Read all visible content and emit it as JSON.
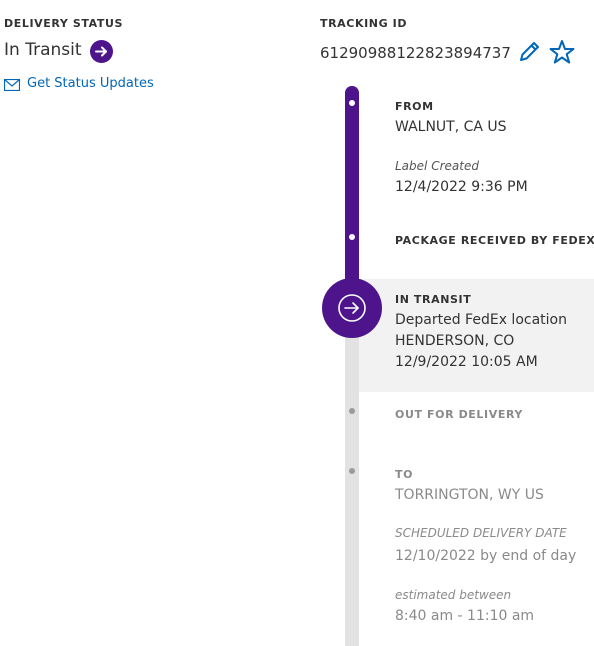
{
  "delivery_status": {
    "heading": "DELIVERY STATUS",
    "status": "In Transit",
    "status_icon": "arrow-right-circle-icon",
    "updates_link": "Get Status Updates",
    "updates_icon": "envelope-icon"
  },
  "tracking": {
    "heading": "TRACKING ID",
    "id": "612909881228238947 37",
    "id_display": "612909881228238947​37",
    "edit_icon": "pencil-icon",
    "favorite_icon": "star-icon"
  },
  "timeline": {
    "from": {
      "label": "FROM",
      "location": "WALNUT, CA US",
      "event_label": "Label Created",
      "event_time": "12/4/2022 9:36 PM"
    },
    "received": {
      "label": "PACKAGE RECEIVED BY FEDEX"
    },
    "in_transit": {
      "label": "IN TRANSIT",
      "event": "Departed FedEx location",
      "location": "HENDERSON, CO",
      "time": "12/9/2022 10:05 AM",
      "icon": "arrow-right-circle-icon"
    },
    "out_for_delivery": {
      "label": "OUT FOR DELIVERY"
    },
    "to": {
      "label": "TO",
      "location": "TORRINGTON, WY US",
      "scheduled_label": "SCHEDULED DELIVERY DATE",
      "scheduled_value": "12/10/2022 by end of day",
      "estimated_label": "estimated between",
      "estimated_value": "8:40 am - 11:10 am"
    }
  },
  "colors": {
    "brand_purple": "#4d148c",
    "link_blue": "#0067b8",
    "track_gray": "#e2e2e2",
    "highlight_bg": "#f2f2f2"
  }
}
